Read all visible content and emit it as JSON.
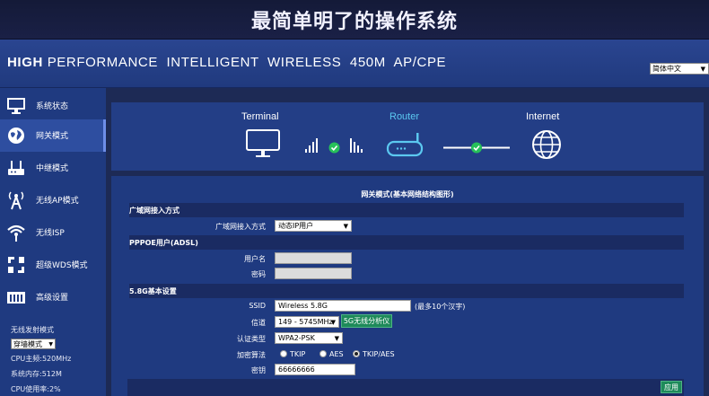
{
  "banner": {
    "title": "最简单明了的操作系统"
  },
  "header": {
    "title_bold": "HIGH",
    "title_rest": "PERFORMANCE  INTELLIGENT  WIRELESS  450M  AP/CPE",
    "language": "简体中文"
  },
  "sidebar": {
    "items": [
      {
        "label": "系统状态",
        "icon": "monitor-icon"
      },
      {
        "label": "网关模式",
        "icon": "globe-icon"
      },
      {
        "label": "中继模式",
        "icon": "router-icon"
      },
      {
        "label": "无线AP模式",
        "icon": "antenna-icon"
      },
      {
        "label": "无线ISP",
        "icon": "wifi-icon"
      },
      {
        "label": "超级WDS模式",
        "icon": "wds-icon"
      },
      {
        "label": "高级设置",
        "icon": "settings-icon"
      }
    ],
    "active_index": 1,
    "tx_mode_label": "无线发射模式",
    "tx_mode_value": "穿墙模式",
    "cpu_freq": "CPU主频:520MHz",
    "memory": "系统内存:512M",
    "cpu_usage": "CPU使用率:2%"
  },
  "diagram": {
    "terminal": "Terminal",
    "router": "Router",
    "internet": "Internet"
  },
  "form": {
    "title": "网关模式(基本网络结构图形)",
    "wan_section": "广域网接入方式",
    "wan_label": "广域网接入方式",
    "wan_value": "动态IP用户",
    "pppoe_section": "PPPOE用户(ADSL)",
    "username_label": "用户名",
    "username_value": "",
    "password_label": "密码",
    "password_value": "",
    "wifi_section": "5.8G基本设置",
    "ssid_label": "SSID",
    "ssid_value": "Wireless 5.8G",
    "ssid_hint": "(最多10个汉字)",
    "channel_label": "信道",
    "channel_value": "149 - 5745MHz",
    "analyzer_button": "5G无线分析仪",
    "auth_label": "认证类型",
    "auth_value": "WPA2-PSK",
    "cipher_label": "加密算法",
    "cipher_options": [
      "TKIP",
      "AES",
      "TKIP/AES"
    ],
    "cipher_selected": "TKIP/AES",
    "key_label": "密钥",
    "key_value": "66666666",
    "apply_button": "应用"
  },
  "colors": {
    "accent_green": "#27c05a",
    "router_cyan": "#5bc8f0",
    "panel_blue": "#1f3a80"
  }
}
